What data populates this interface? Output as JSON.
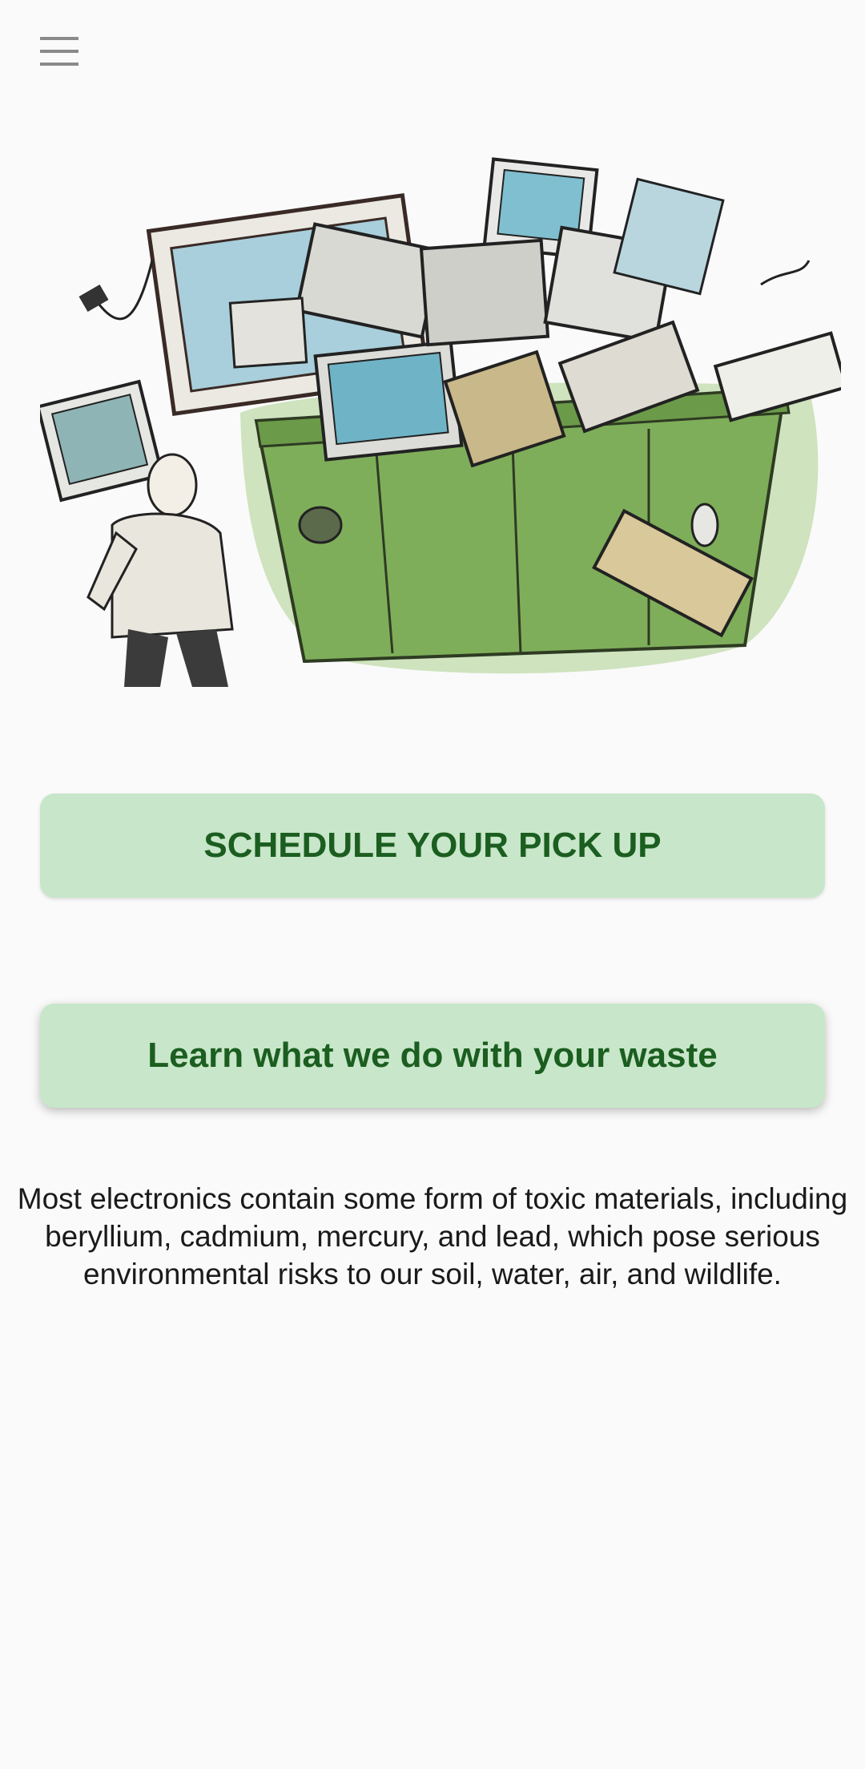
{
  "app": {
    "menu_icon": "hamburger-menu-icon",
    "hero_image": "e-waste-dumpster-illustration"
  },
  "buttons": {
    "schedule_label": "SCHEDULE YOUR PICK UP",
    "learn_label": "Learn what we do with your waste"
  },
  "info": {
    "text": "Most electronics contain some form of toxic materials, including beryllium, cadmium, mercury, and lead, which pose serious environmental risks to our soil, water, air, and wildlife."
  },
  "colors": {
    "background": "#fafafa",
    "button_bg": "#c8e6c9",
    "button_text": "#1b5e20",
    "menu_icon": "#8a8a8a",
    "dumpster_green": "#7fae5a"
  }
}
